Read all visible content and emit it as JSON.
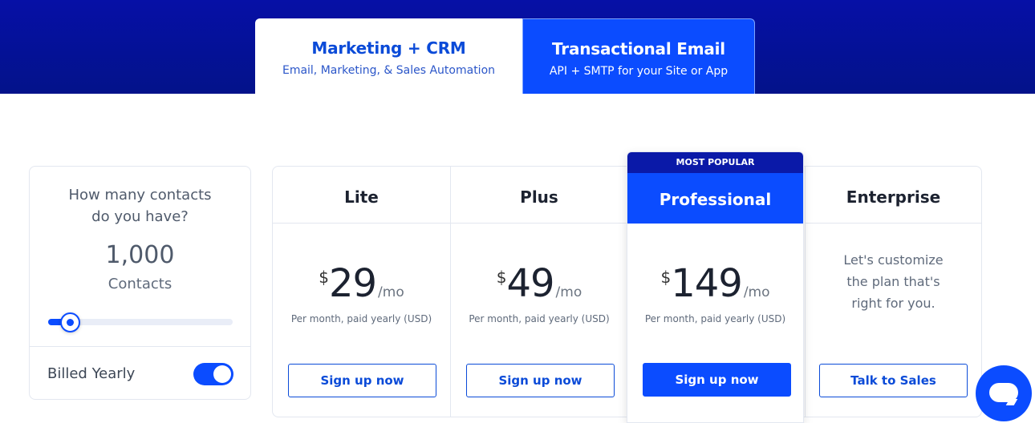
{
  "tabs": [
    {
      "title": "Marketing + CRM",
      "subtitle": "Email, Marketing, & Sales Automation",
      "active": true
    },
    {
      "title": "Transactional Email",
      "subtitle": "API + SMTP for your Site or App",
      "active": false
    }
  ],
  "contacts": {
    "question": "How many contacts do you have?",
    "value": "1,000",
    "unit": "Contacts",
    "slider_level": 0.12
  },
  "billing": {
    "label": "Billed Yearly",
    "toggle_on": true
  },
  "plans": [
    {
      "name": "Lite",
      "currency": "$",
      "amount": "29",
      "period": "/mo",
      "note": "Per month, paid yearly (USD)",
      "cta": "Sign up now"
    },
    {
      "name": "Plus",
      "currency": "$",
      "amount": "49",
      "period": "/mo",
      "note": "Per month, paid yearly (USD)",
      "cta": "Sign up now"
    },
    {
      "name": "Professional",
      "badge": "MOST POPULAR",
      "currency": "$",
      "amount": "149",
      "period": "/mo",
      "note": "Per month, paid yearly (USD)",
      "cta": "Sign up now"
    },
    {
      "name": "Enterprise",
      "description": "Let's customize the plan that's right for you.",
      "cta": "Talk to Sales"
    }
  ],
  "colors": {
    "brand_blue": "#0b4cff",
    "hero_navy": "#0610a6",
    "badge_navy": "#0a19a8"
  },
  "icons": {
    "chat": "chat-bubble-icon"
  }
}
